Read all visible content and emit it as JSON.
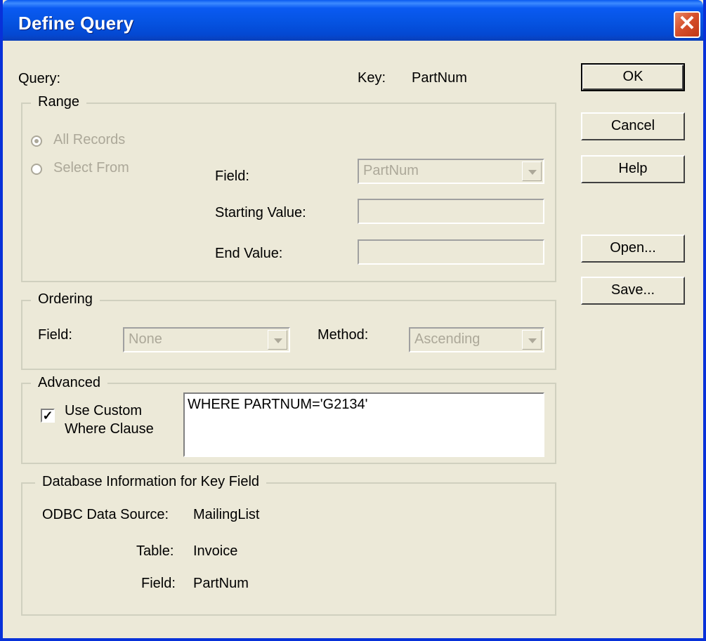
{
  "window": {
    "title": "Define Query",
    "close_glyph": "✕"
  },
  "header": {
    "query_label": "Query:",
    "key_label": "Key:",
    "key_value": "PartNum"
  },
  "buttons": {
    "ok": "OK",
    "cancel": "Cancel",
    "help": "Help",
    "open": "Open...",
    "save": "Save..."
  },
  "range": {
    "title": "Range",
    "all_records": "All Records",
    "select_from": "Select From",
    "selected": "all_records",
    "field_label": "Field:",
    "field_value": "PartNum",
    "start_label": "Starting Value:",
    "start_value": "",
    "end_label": "End Value:",
    "end_value": ""
  },
  "ordering": {
    "title": "Ordering",
    "field_label": "Field:",
    "field_value": "None",
    "method_label": "Method:",
    "method_value": "Ascending"
  },
  "advanced": {
    "title": "Advanced",
    "use_custom_line1": "Use Custom",
    "use_custom_line2": "Where Clause",
    "use_custom_checked": true,
    "check_glyph": "✓",
    "where_clause": "WHERE PARTNUM='G2134'"
  },
  "dbinfo": {
    "title": "Database Information for Key Field",
    "source_label": "ODBC Data Source:",
    "source_value": "MailingList",
    "table_label": "Table:",
    "table_value": "Invoice",
    "field_label": "Field:",
    "field_value": "PartNum"
  }
}
